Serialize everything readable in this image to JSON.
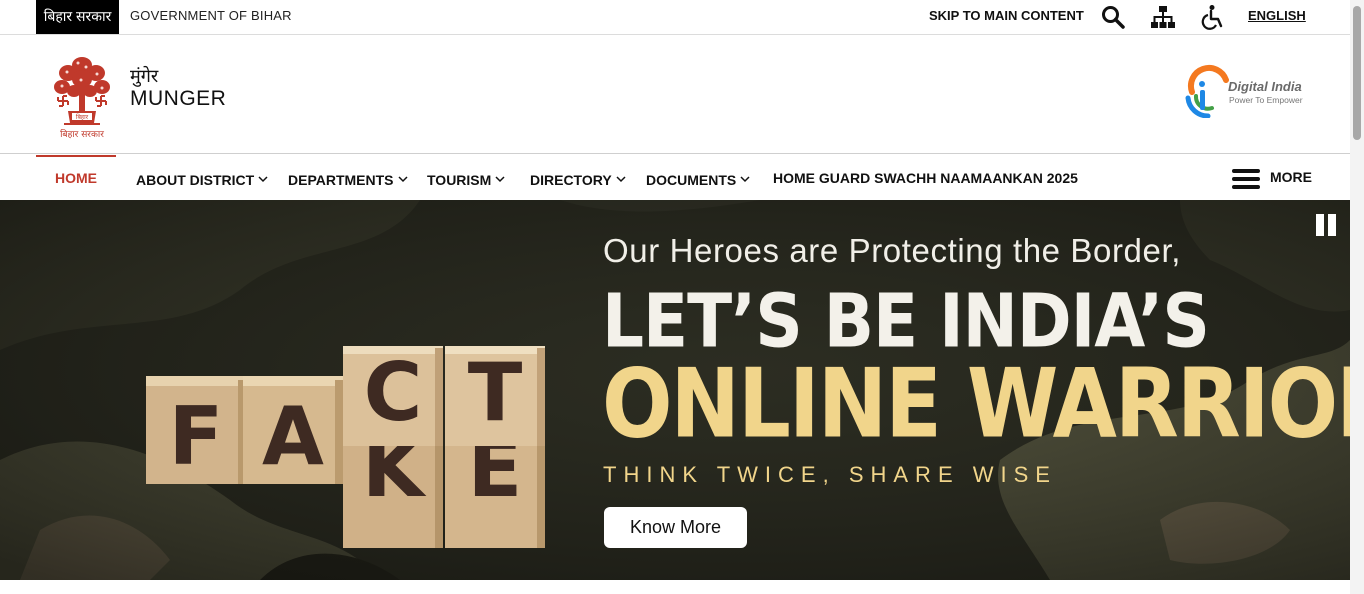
{
  "topbar": {
    "gov_hindi": "बिहार सरकार",
    "gov_english": "GOVERNMENT OF BIHAR",
    "skip_link": "SKIP TO MAIN CONTENT",
    "icons": [
      "search-icon",
      "sitemap-icon",
      "accessibility-icon"
    ],
    "language": "ENGLISH"
  },
  "header": {
    "emblem_caption": "बिहार सरकार",
    "district_hindi": "मुंगेर",
    "district_english": "MUNGER",
    "digital_india_title": "Digital India",
    "digital_india_tagline": "Power To Empower"
  },
  "nav": {
    "items": [
      {
        "label": "HOME",
        "active": true,
        "dropdown": false
      },
      {
        "label": "ABOUT DISTRICT",
        "active": false,
        "dropdown": true
      },
      {
        "label": "DEPARTMENTS",
        "active": false,
        "dropdown": true
      },
      {
        "label": "TOURISM",
        "active": false,
        "dropdown": true
      },
      {
        "label": "DIRECTORY",
        "active": false,
        "dropdown": true
      },
      {
        "label": "DOCUMENTS",
        "active": false,
        "dropdown": true
      },
      {
        "label": "HOME GUARD SWACHH NAAMAANKAN 2025",
        "active": false,
        "dropdown": false
      }
    ],
    "more_label": "MORE",
    "active_color": "#c0392b"
  },
  "banner": {
    "line1": "Our Heroes are Protecting the Border,",
    "line2": "LET’S BE INDIA’S",
    "line3": "ONLINE WARRIORS",
    "line4": "THINK TWICE, SHARE WISE",
    "button": "Know More",
    "blocks": [
      "F",
      "A",
      "K",
      "E",
      "C",
      "T"
    ],
    "accent_color": "#f1d58b",
    "pause_icon": "pause-icon"
  }
}
